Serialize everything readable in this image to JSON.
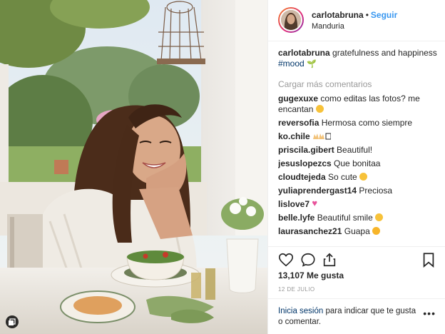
{
  "header": {
    "username": "carlotabruna",
    "separator": "•",
    "follow_label": "Seguir",
    "location": "Manduria"
  },
  "caption": {
    "username": "carlotabruna",
    "text": "gratefulness and happiness",
    "hashtag": "#mood",
    "emoji": "🌱"
  },
  "load_more_label": "Cargar más comentarios",
  "comments": [
    {
      "user": "gugexuxe",
      "text": "como editas las fotos? me encantan",
      "emoji": "smiling-face"
    },
    {
      "user": "reversofia",
      "text": "Hermosa como siempre",
      "emoji": ""
    },
    {
      "user": "ko.chile",
      "text": "",
      "emoji": "raising-hands"
    },
    {
      "user": "priscila.gibert",
      "text": "Beautiful!",
      "emoji": ""
    },
    {
      "user": "jesuslopezcs",
      "text": "Que bonitaa",
      "emoji": ""
    },
    {
      "user": "cloudtejeda",
      "text": "So cute",
      "emoji": "blush-face"
    },
    {
      "user": "yuliaprendergast14",
      "text": "Preciosa",
      "emoji": ""
    },
    {
      "user": "lislove7",
      "text": "",
      "emoji": "sparkling-heart"
    },
    {
      "user": "belle.lyfe",
      "text": "Beautiful smile",
      "emoji": "heart-eyes"
    },
    {
      "user": "laurasanchez21",
      "text": "Guapa",
      "emoji": "kiss-face"
    }
  ],
  "actions": {
    "likes": "13,107 Me gusta",
    "date": "12 DE JULIO"
  },
  "login": {
    "link": "Inicia sesión",
    "text": "para indicar que te gusta o comentar.",
    "more": "•••"
  },
  "colors": {
    "accent": "#3897f0",
    "link": "#003569",
    "muted": "#999999",
    "border": "#efefef"
  },
  "icons": [
    "heart-icon",
    "comment-icon",
    "share-icon",
    "bookmark-icon",
    "carousel-badge-icon"
  ]
}
